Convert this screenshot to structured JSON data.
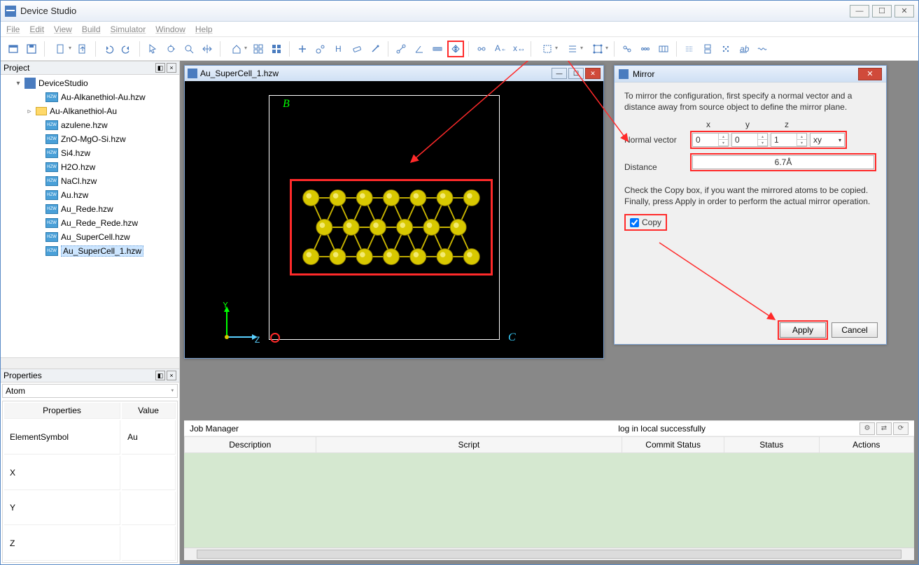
{
  "app": {
    "title": "Device Studio"
  },
  "menu": [
    "File",
    "Edit",
    "View",
    "Build",
    "Simulator",
    "Window",
    "Help"
  ],
  "toolbar": {
    "mirror_tooltip": "Mirror"
  },
  "project": {
    "panel_title": "Project",
    "root": "DeviceStudio",
    "items": [
      {
        "label": "Au-Alkanethiol-Au.hzw",
        "type": "file"
      },
      {
        "label": "Au-Alkanethiol-Au",
        "type": "folder"
      },
      {
        "label": "azulene.hzw",
        "type": "file"
      },
      {
        "label": "ZnO-MgO-Si.hzw",
        "type": "file"
      },
      {
        "label": "Si4.hzw",
        "type": "file"
      },
      {
        "label": "H2O.hzw",
        "type": "file"
      },
      {
        "label": "NaCl.hzw",
        "type": "file"
      },
      {
        "label": "Au.hzw",
        "type": "file"
      },
      {
        "label": "Au_Rede.hzw",
        "type": "file"
      },
      {
        "label": "Au_Rede_Rede.hzw",
        "type": "file"
      },
      {
        "label": "Au_SuperCell.hzw",
        "type": "file"
      },
      {
        "label": "Au_SuperCell_1.hzw",
        "type": "file",
        "selected": true
      }
    ]
  },
  "properties": {
    "panel_title": "Properties",
    "selector": "Atom",
    "headers": [
      "Properties",
      "Value"
    ],
    "rows": [
      {
        "k": "ElementSymbol",
        "v": "Au"
      },
      {
        "k": "X",
        "v": ""
      },
      {
        "k": "Y",
        "v": ""
      },
      {
        "k": "Z",
        "v": ""
      }
    ]
  },
  "document": {
    "title": "Au_SuperCell_1.hzw",
    "axes": {
      "x": "Z",
      "y": "Y"
    },
    "labels": {
      "B": "B",
      "C": "C"
    }
  },
  "mirror": {
    "title": "Mirror",
    "intro": "To mirror the configuration, first specify a normal vector and a distance away from source object to define the mirror plane.",
    "col_x": "x",
    "col_y": "y",
    "col_z": "z",
    "normal_label": "Normal vector",
    "normal": {
      "x": "0",
      "y": "0",
      "z": "1",
      "plane": "xy"
    },
    "distance_label": "Distance",
    "distance": "6.7Å",
    "copy_text": "Check the Copy box, if you want the mirrored atoms to be copied. Finally, press Apply in order to perform the actual mirror operation.",
    "copy_label": "Copy",
    "copy_checked": true,
    "apply": "Apply",
    "cancel": "Cancel"
  },
  "job": {
    "title": "Job Manager",
    "status": "log in local successfully",
    "headers": [
      "Description",
      "Script",
      "Commit Status",
      "Status",
      "Actions"
    ]
  }
}
